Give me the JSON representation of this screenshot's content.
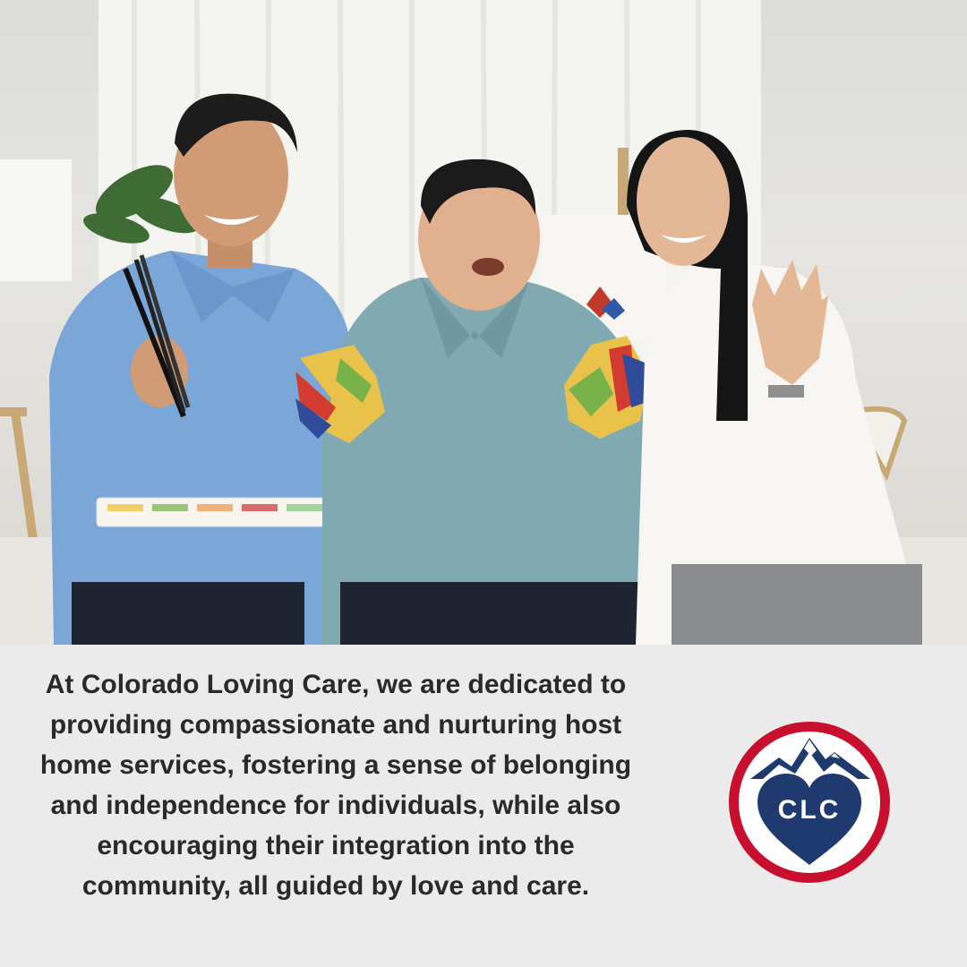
{
  "photo": {
    "subject": "Three people seated on a sofa in a bright living room: a man holding paintbrushes and a paint palette, a young man showing paint-covered hands, and a woman waving"
  },
  "caption": {
    "text": "At Colorado Loving Care, we are dedicated to providing compassionate and nurturing host home services, fostering a sense of belonging and independence for individuals, while also encouraging their integration into the community, all guided by love and care."
  },
  "logo": {
    "text": "CLC",
    "colors": {
      "ring_red": "#c8102e",
      "navy": "#1f3a6e",
      "white": "#ffffff"
    }
  }
}
